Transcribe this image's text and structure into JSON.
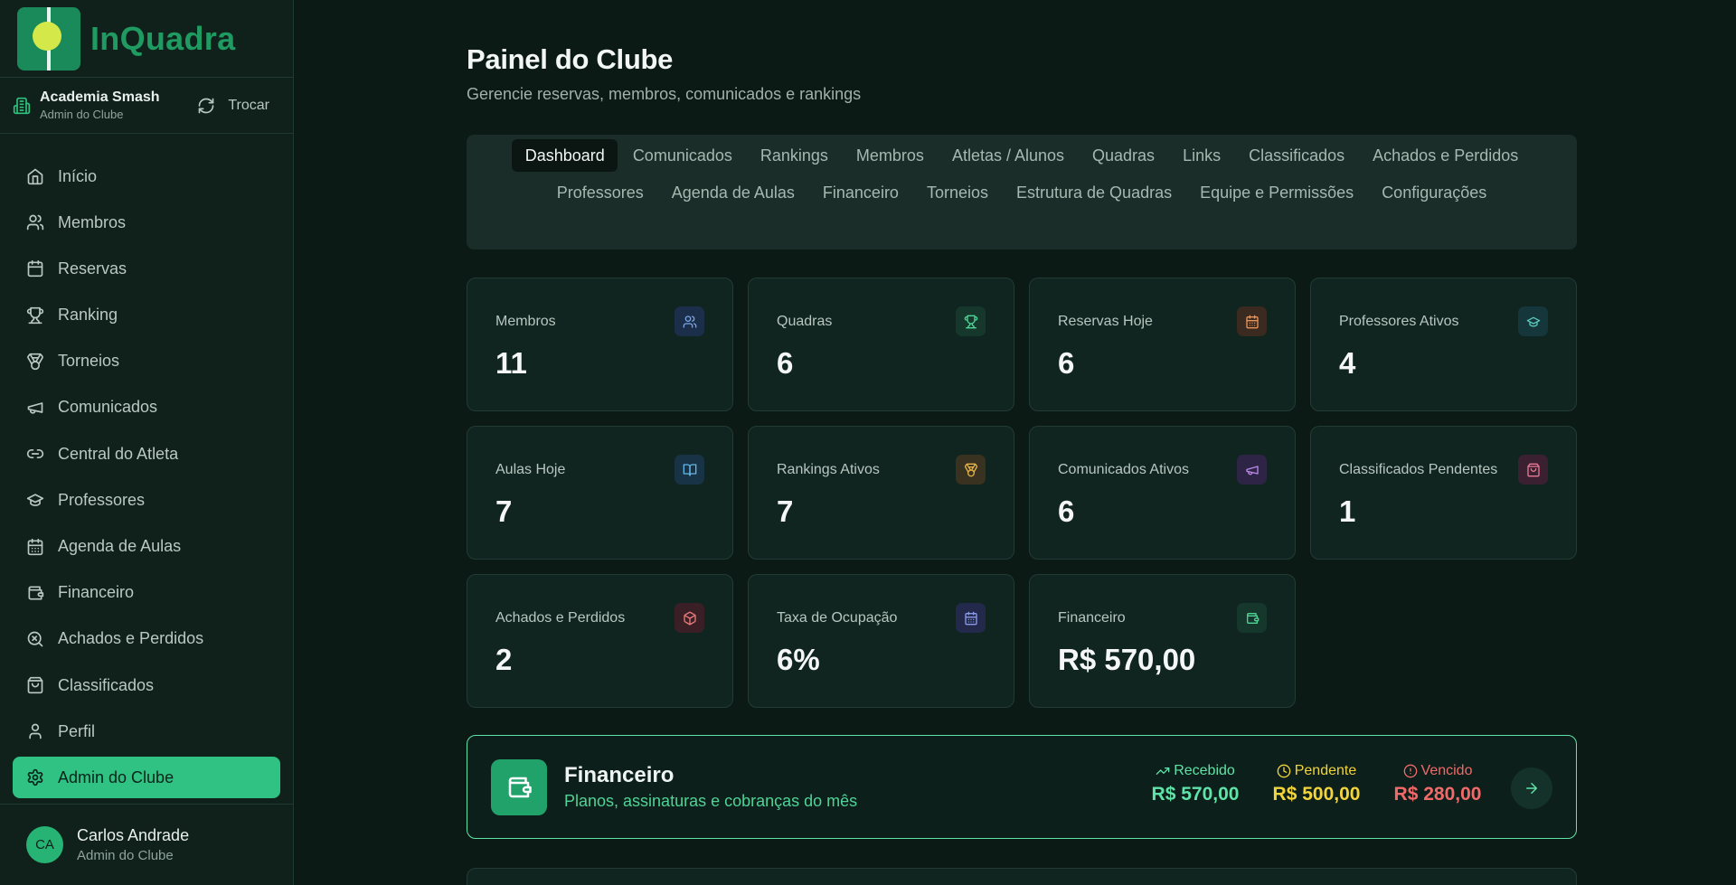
{
  "brand": {
    "name": "InQuadra"
  },
  "club": {
    "name": "Academia Smash",
    "role": "Admin do Clube",
    "switch_label": "Trocar"
  },
  "sidebar": {
    "items": [
      {
        "label": "Início",
        "icon": "home-icon"
      },
      {
        "label": "Membros",
        "icon": "users-icon"
      },
      {
        "label": "Reservas",
        "icon": "calendar-icon"
      },
      {
        "label": "Ranking",
        "icon": "trophy-icon"
      },
      {
        "label": "Torneios",
        "icon": "medal-icon"
      },
      {
        "label": "Comunicados",
        "icon": "megaphone-icon"
      },
      {
        "label": "Central do Atleta",
        "icon": "link-icon"
      },
      {
        "label": "Professores",
        "icon": "graduation-cap-icon"
      },
      {
        "label": "Agenda de Aulas",
        "icon": "calendar-days-icon"
      },
      {
        "label": "Financeiro",
        "icon": "wallet-icon"
      },
      {
        "label": "Achados e Perdidos",
        "icon": "search-x-icon"
      },
      {
        "label": "Classificados",
        "icon": "shopping-bag-icon"
      },
      {
        "label": "Perfil",
        "icon": "user-icon"
      },
      {
        "label": "Admin do Clube",
        "icon": "gear-icon",
        "active": true
      }
    ]
  },
  "user": {
    "initials": "CA",
    "name": "Carlos Andrade",
    "role": "Admin do Clube"
  },
  "header": {
    "title": "Painel do Clube",
    "subtitle": "Gerencie reservas, membros, comunicados e rankings"
  },
  "tabs": [
    {
      "label": "Dashboard",
      "active": true
    },
    {
      "label": "Comunicados"
    },
    {
      "label": "Rankings"
    },
    {
      "label": "Membros"
    },
    {
      "label": "Atletas / Alunos"
    },
    {
      "label": "Quadras"
    },
    {
      "label": "Links"
    },
    {
      "label": "Classificados"
    },
    {
      "label": "Achados e Perdidos"
    },
    {
      "label": "Professores"
    },
    {
      "label": "Agenda de Aulas"
    },
    {
      "label": "Financeiro"
    },
    {
      "label": "Torneios"
    },
    {
      "label": "Estrutura de Quadras"
    },
    {
      "label": "Equipe e Permissões"
    },
    {
      "label": "Configurações"
    }
  ],
  "stats": [
    {
      "label": "Membros",
      "value": "11",
      "icon": "users-icon",
      "icon_color": "#7aa6e8",
      "icon_bg": "#1c2f4a"
    },
    {
      "label": "Quadras",
      "value": "6",
      "icon": "trophy-icon",
      "icon_color": "#4fd396",
      "icon_bg": "#16382c"
    },
    {
      "label": "Reservas Hoje",
      "value": "6",
      "icon": "calendar-icon",
      "icon_color": "#e8955a",
      "icon_bg": "#3a2a20"
    },
    {
      "label": "Professores Ativos",
      "value": "4",
      "icon": "graduation-cap-icon",
      "icon_color": "#5cc9bf",
      "icon_bg": "#15363a"
    },
    {
      "label": "Aulas Hoje",
      "value": "7",
      "icon": "book-open-icon",
      "icon_color": "#66b6e6",
      "icon_bg": "#173345"
    },
    {
      "label": "Rankings Ativos",
      "value": "7",
      "icon": "medal-icon",
      "icon_color": "#e3b14a",
      "icon_bg": "#3a3220"
    },
    {
      "label": "Comunicados Ativos",
      "value": "6",
      "icon": "megaphone-icon",
      "icon_color": "#b98ae8",
      "icon_bg": "#2e2445"
    },
    {
      "label": "Classificados Pendentes",
      "value": "1",
      "icon": "shopping-bag-icon",
      "icon_color": "#e87a96",
      "icon_bg": "#3a2030"
    },
    {
      "label": "Achados e Perdidos",
      "value": "2",
      "icon": "package-icon",
      "icon_color": "#e87a7a",
      "icon_bg": "#3a2026"
    },
    {
      "label": "Taxa de Ocupação",
      "value": "6%",
      "icon": "calendar-days-icon",
      "icon_color": "#8a9ae8",
      "icon_bg": "#23294a"
    },
    {
      "label": "Financeiro",
      "value": "R$ 570,00",
      "icon": "wallet-icon",
      "icon_color": "#4fd396",
      "icon_bg": "#16382c"
    }
  ],
  "finance_banner": {
    "title": "Financeiro",
    "subtitle": "Planos, assinaturas e cobranças do mês",
    "received": {
      "label": "Recebido",
      "value": "R$ 570,00",
      "color": "#5fe3a8"
    },
    "pending": {
      "label": "Pendente",
      "value": "R$ 500,00",
      "color": "#f2d43d"
    },
    "overdue": {
      "label": "Vencido",
      "value": "R$ 280,00",
      "color": "#f06a6a"
    }
  },
  "colors": {
    "accent": "#2fc283",
    "background": "#0c1a16",
    "sidebar": "#10211c"
  }
}
